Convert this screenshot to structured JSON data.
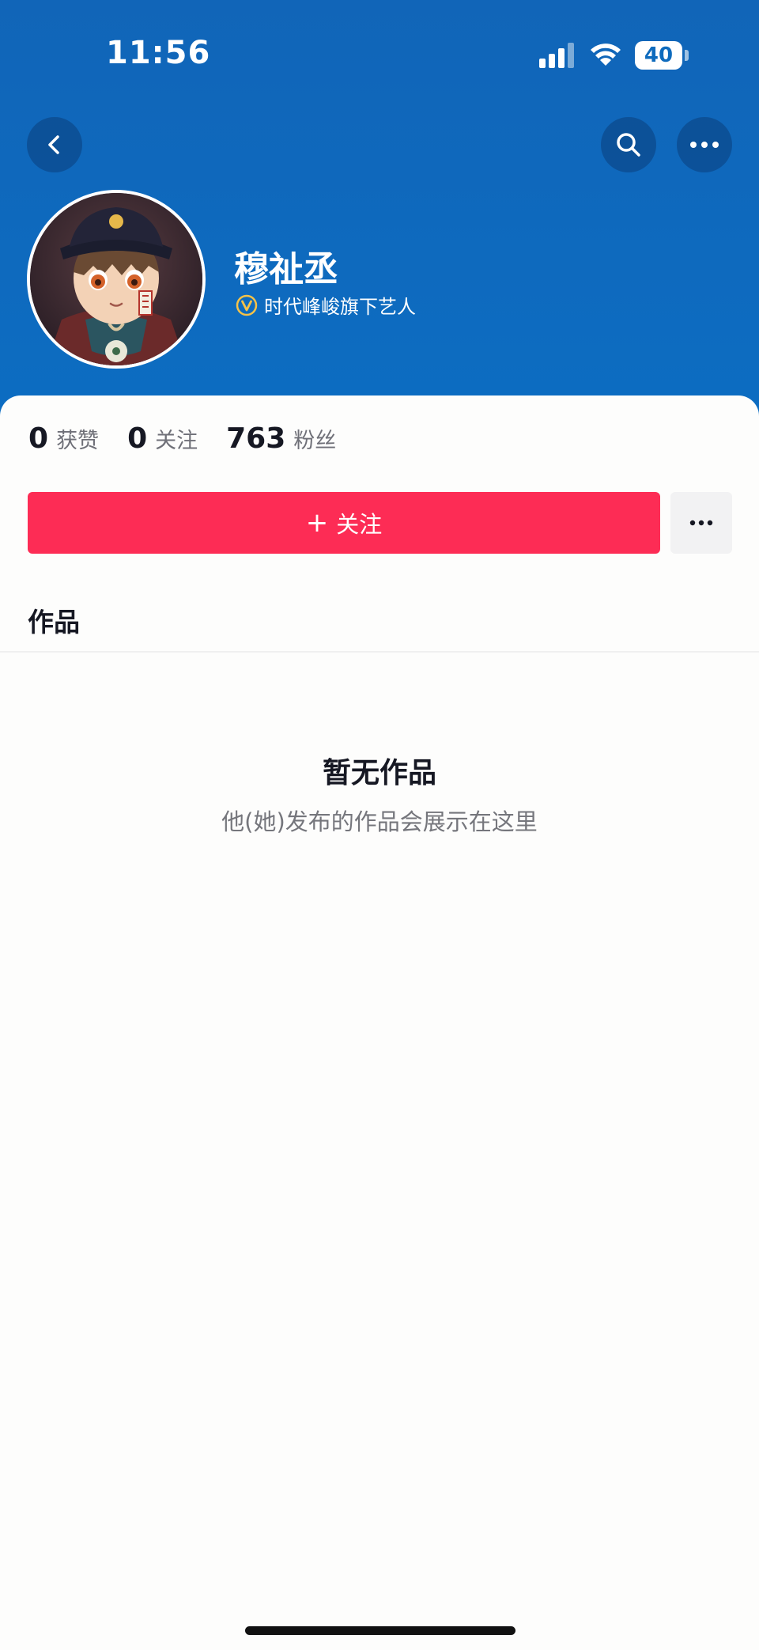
{
  "status_bar": {
    "time": "11:56",
    "battery_level": "40"
  },
  "profile": {
    "name": "穆祉丞",
    "verification": "时代峰峻旗下艺人"
  },
  "stats": [
    {
      "value": "0",
      "label": "获赞"
    },
    {
      "value": "0",
      "label": "关注"
    },
    {
      "value": "763",
      "label": "粉丝"
    }
  ],
  "actions": {
    "follow_label": "关注",
    "follow_plus": "+"
  },
  "tabs": {
    "works_label": "作品"
  },
  "empty_state": {
    "title": "暂无作品",
    "description": "他(她)发布的作品会展示在这里"
  },
  "colors": {
    "header_bg": "#0e6bbd",
    "follow_button": "#fd2c55",
    "verify_badge": "#f5c248"
  },
  "icons": {
    "back": "back-icon",
    "search": "search-icon",
    "more": "more-icon",
    "verify": "verified-badge-icon"
  }
}
